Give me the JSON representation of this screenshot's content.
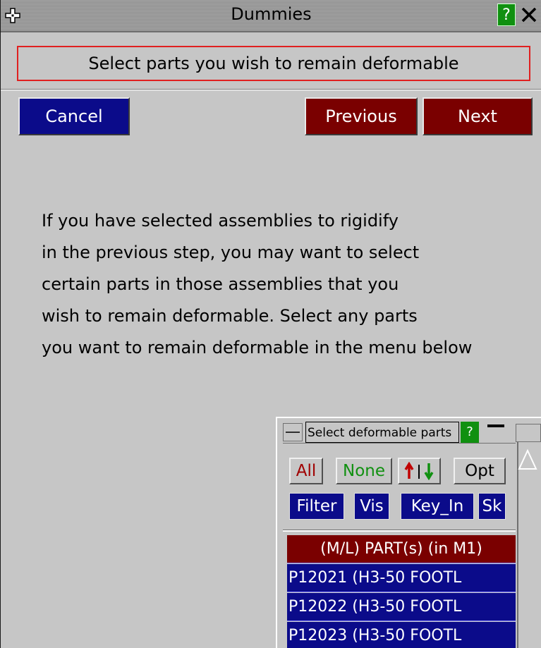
{
  "window": {
    "title": "Dummies",
    "help_label": "?",
    "close_label": "X"
  },
  "prompt": "Select parts you wish to remain deformable",
  "buttons": {
    "cancel": "Cancel",
    "previous": "Previous",
    "next": "Next"
  },
  "info_lines": [
    "If you have selected assemblies to rigidify",
    "in the previous step, you may want to select",
    "certain parts in those assemblies that you",
    "wish to remain deformable. Select any parts",
    "you want to remain deformable in the menu below"
  ],
  "menu": {
    "title": "Select deformable parts",
    "help_label": "?",
    "buttons": {
      "all": "All",
      "none": "None",
      "opt": "Opt",
      "filter": "Filter",
      "vis": "Vis",
      "key_in": "Key_In",
      "sk": "Sk"
    },
    "list_header": "(M/L) PART(s) (in M1)",
    "items": [
      "P12021 (H3-50 FOOTL",
      "P12022 (H3-50 FOOTL",
      "P12023 (H3-50 FOOTL"
    ]
  },
  "colors": {
    "panel": "#c6c6c6",
    "blue_button": "#0b0b8a",
    "red_button": "#7a0000",
    "help_green": "#109010",
    "prompt_border": "#e02020"
  }
}
